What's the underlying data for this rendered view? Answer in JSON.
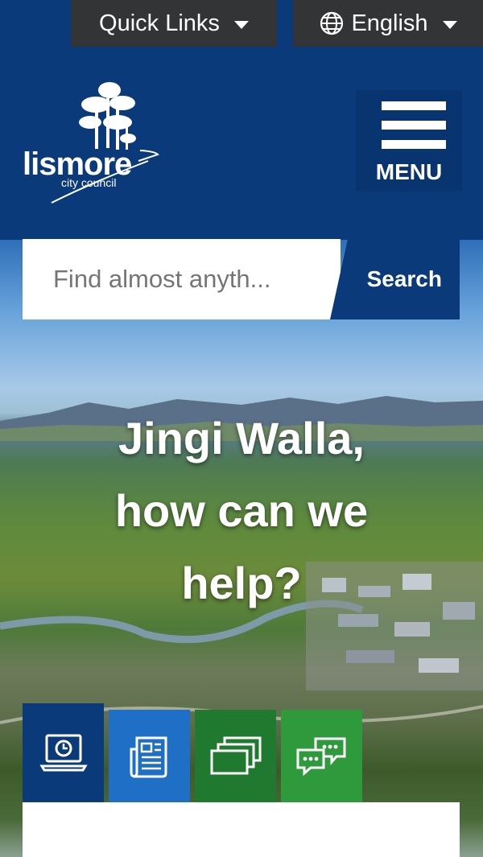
{
  "topbar": {
    "quick_links_label": "Quick Links",
    "language_label": "English"
  },
  "header": {
    "logo_word": "lismore",
    "logo_subtitle": "city council",
    "menu_label": "MENU"
  },
  "search": {
    "placeholder": "Find almost anyth...",
    "button_label": "Search"
  },
  "hero": {
    "headline_line1": "Jingi Walla,",
    "headline_line2": "how can we",
    "headline_line3": "help?"
  },
  "tiles": [
    {
      "icon": "laptop-clock-icon",
      "color": "#0b3a7a"
    },
    {
      "icon": "newspaper-icon",
      "color": "#1f6fc6"
    },
    {
      "icon": "stacked-windows-icon",
      "color": "#1f7a2f"
    },
    {
      "icon": "chat-bubbles-icon",
      "color": "#2e9a3c"
    }
  ],
  "colors": {
    "brand_navy": "#0b3a7a",
    "utility_gray": "#333436"
  }
}
